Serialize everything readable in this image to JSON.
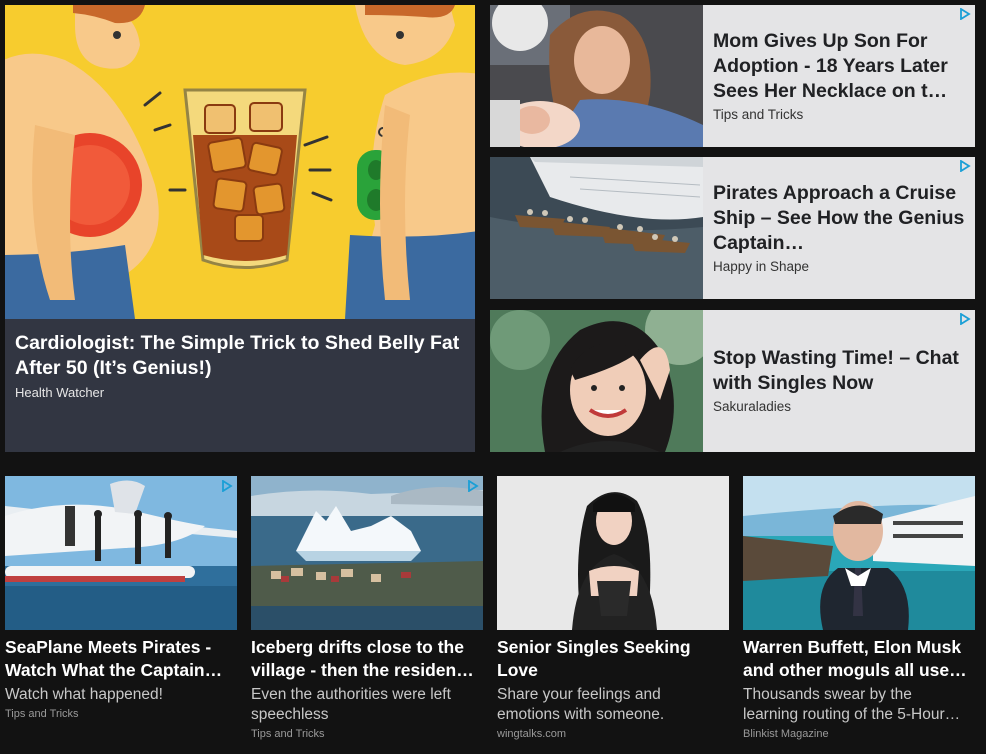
{
  "hero": {
    "title": "Cardiologist: The Simple Trick to Shed Belly Fat After 50 (It’s Genius!)",
    "source": "Health Watcher"
  },
  "side": [
    {
      "title": "Mom Gives Up Son For Adoption - 18 Years Later Sees Her Necklace on t…",
      "source": "Tips and Tricks"
    },
    {
      "title": "Pirates Approach a Cruise Ship – See How the Genius Captain…",
      "source": "Happy in Shape"
    },
    {
      "title": "Stop Wasting Time! – Chat with Singles Now",
      "source": "Sakuraladies"
    }
  ],
  "cards": [
    {
      "title_lines": [
        "SeaPlane Meets Pirates -",
        "Watch What the Captain…"
      ],
      "desc_lines": [
        "Watch what happened!"
      ],
      "source": "Tips and Tricks"
    },
    {
      "title_lines": [
        "Iceberg drifts close to the",
        "village - then the residen…"
      ],
      "desc_lines": [
        "Even the authorities were left",
        "speechless"
      ],
      "source": "Tips and Tricks"
    },
    {
      "title_lines": [
        "Senior Singles Seeking",
        "Love"
      ],
      "desc_lines": [
        "Share your feelings and",
        "emotions with someone."
      ],
      "source": "wingtalks.com"
    },
    {
      "title_lines": [
        "Warren Buffett, Elon Musk",
        "and other moguls all use…"
      ],
      "desc_lines": [
        "Thousands swear by the",
        "learning routing of the 5-Hour…"
      ],
      "source": "Blinkist Magazine"
    }
  ],
  "colors": {
    "page_bg": "#121212",
    "hero_caption_bg": "#323642",
    "side_card_bg": "#e4e4e6",
    "adchoices": "#1a9fd6"
  },
  "icons": {
    "adchoices": "adchoices-icon"
  }
}
